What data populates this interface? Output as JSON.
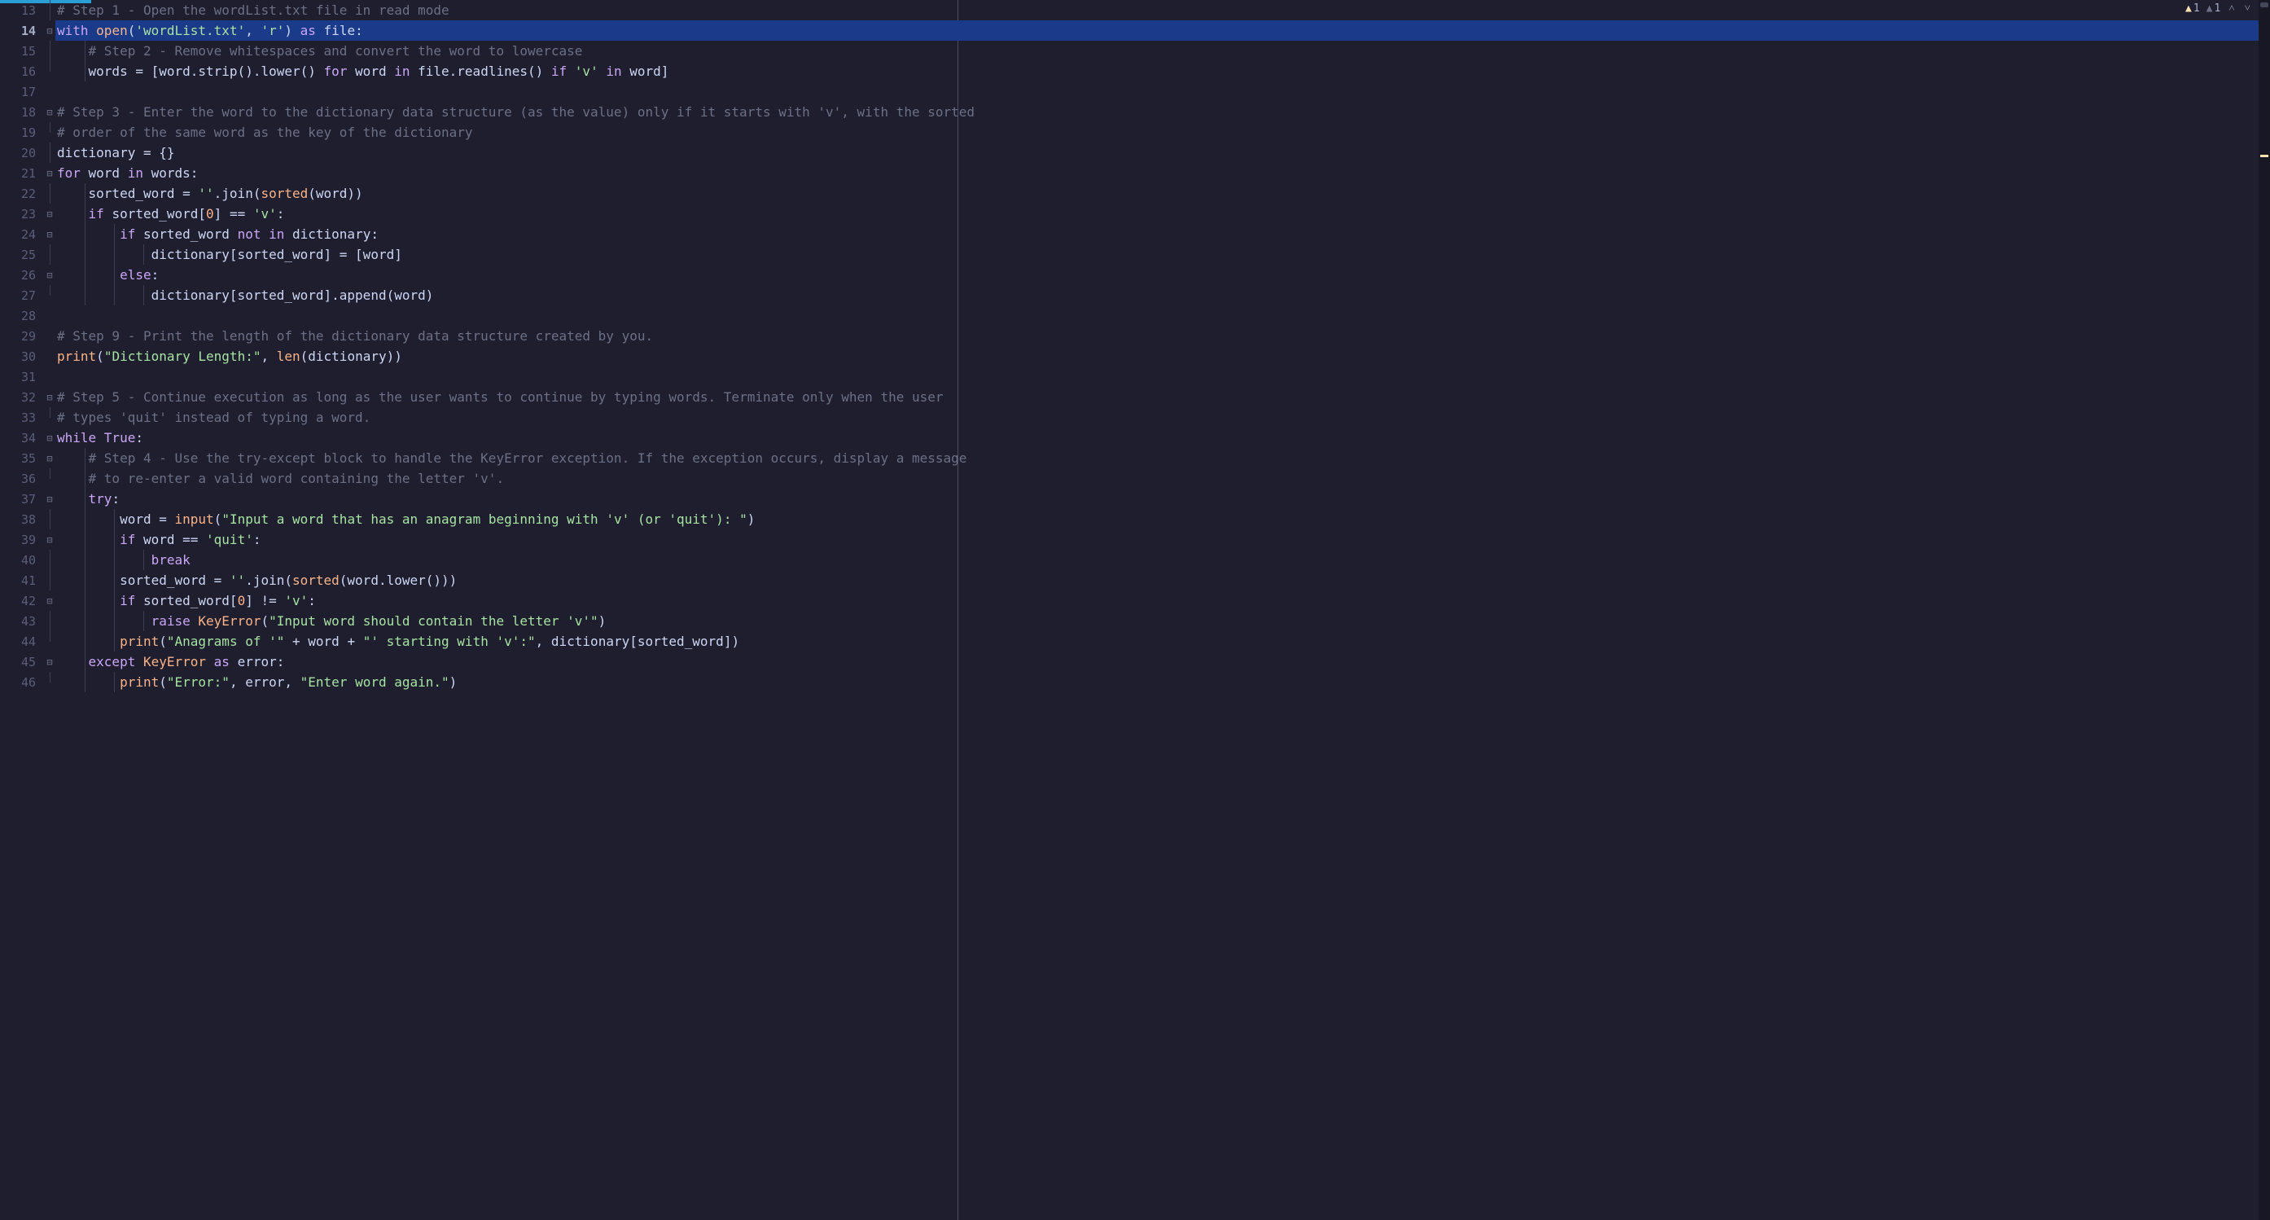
{
  "inspections": {
    "warn_active": "1",
    "warn_dim": "1"
  },
  "lines": [
    {
      "n": 13,
      "current": false,
      "hl": false,
      "fold": "line",
      "guides": [],
      "tokens": [
        {
          "t": "# Step 1 - Open the wordList.txt file in read mode",
          "c": "c-comment"
        }
      ]
    },
    {
      "n": 14,
      "current": true,
      "hl": true,
      "fold": "has",
      "guides": [],
      "tokens": [
        {
          "t": "with ",
          "c": "c-kw"
        },
        {
          "t": "open",
          "c": "c-builtin"
        },
        {
          "t": "(",
          "c": "c-id"
        },
        {
          "t": "'wordList.txt'",
          "c": "c-str"
        },
        {
          "t": ", ",
          "c": "c-id"
        },
        {
          "t": "'r'",
          "c": "c-str"
        },
        {
          "t": ") ",
          "c": "c-id"
        },
        {
          "t": "as ",
          "c": "c-kw"
        },
        {
          "t": "file:",
          "c": "c-id"
        }
      ]
    },
    {
      "n": 15,
      "current": false,
      "hl": false,
      "fold": "line",
      "guides": [
        1
      ],
      "tokens": [
        {
          "t": "    ",
          "c": ""
        },
        {
          "t": "# Step 2 - Remove whitespaces and convert the word to lowercase",
          "c": "c-comment"
        }
      ]
    },
    {
      "n": 16,
      "current": false,
      "hl": false,
      "fold": "end",
      "guides": [
        1
      ],
      "tokens": [
        {
          "t": "    words = [word.strip().lower() ",
          "c": "c-id"
        },
        {
          "t": "for ",
          "c": "c-kw"
        },
        {
          "t": "word ",
          "c": "c-id"
        },
        {
          "t": "in ",
          "c": "c-kw"
        },
        {
          "t": "file.readlines() ",
          "c": "c-id"
        },
        {
          "t": "if ",
          "c": "c-kw"
        },
        {
          "t": "'v'",
          "c": "c-str"
        },
        {
          "t": " ",
          "c": ""
        },
        {
          "t": "in ",
          "c": "c-kw"
        },
        {
          "t": "word]",
          "c": "c-id"
        }
      ]
    },
    {
      "n": 17,
      "current": false,
      "hl": false,
      "fold": "",
      "guides": [],
      "tokens": [
        {
          "t": "",
          "c": ""
        }
      ]
    },
    {
      "n": 18,
      "current": false,
      "hl": false,
      "fold": "has",
      "guides": [],
      "tokens": [
        {
          "t": "# Step 3 - Enter the word to the dictionary data structure (as the value) only if it starts with 'v', with the sorted",
          "c": "c-comment"
        }
      ]
    },
    {
      "n": 19,
      "current": false,
      "hl": false,
      "fold": "end",
      "guides": [],
      "tokens": [
        {
          "t": "# order of the same word as the key of the dictionary",
          "c": "c-comment"
        }
      ]
    },
    {
      "n": 20,
      "current": false,
      "hl": false,
      "fold": "line",
      "guides": [],
      "tokens": [
        {
          "t": "dictionary = {}",
          "c": "c-id"
        }
      ]
    },
    {
      "n": 21,
      "current": false,
      "hl": false,
      "fold": "has",
      "guides": [],
      "tokens": [
        {
          "t": "for ",
          "c": "c-kw"
        },
        {
          "t": "word ",
          "c": "c-id"
        },
        {
          "t": "in ",
          "c": "c-kw"
        },
        {
          "t": "words:",
          "c": "c-id"
        }
      ]
    },
    {
      "n": 22,
      "current": false,
      "hl": false,
      "fold": "line",
      "guides": [
        1
      ],
      "tokens": [
        {
          "t": "    sorted_word = ",
          "c": "c-id"
        },
        {
          "t": "''",
          "c": "c-str"
        },
        {
          "t": ".join(",
          "c": "c-id"
        },
        {
          "t": "sorted",
          "c": "c-builtin"
        },
        {
          "t": "(word))",
          "c": "c-id"
        }
      ]
    },
    {
      "n": 23,
      "current": false,
      "hl": false,
      "fold": "has",
      "guides": [
        1
      ],
      "tokens": [
        {
          "t": "    ",
          "c": ""
        },
        {
          "t": "if ",
          "c": "c-kw"
        },
        {
          "t": "sorted_word[",
          "c": "c-id"
        },
        {
          "t": "0",
          "c": "c-num"
        },
        {
          "t": "] == ",
          "c": "c-id"
        },
        {
          "t": "'v'",
          "c": "c-str"
        },
        {
          "t": ":",
          "c": "c-id"
        }
      ]
    },
    {
      "n": 24,
      "current": false,
      "hl": false,
      "fold": "has",
      "guides": [
        1,
        2
      ],
      "tokens": [
        {
          "t": "        ",
          "c": ""
        },
        {
          "t": "if ",
          "c": "c-kw"
        },
        {
          "t": "sorted_word ",
          "c": "c-id"
        },
        {
          "t": "not in ",
          "c": "c-kw"
        },
        {
          "t": "dictionary:",
          "c": "c-id"
        }
      ]
    },
    {
      "n": 25,
      "current": false,
      "hl": false,
      "fold": "line",
      "guides": [
        1,
        2,
        3
      ],
      "tokens": [
        {
          "t": "            dictionary[sorted_word] = [word]",
          "c": "c-id"
        }
      ]
    },
    {
      "n": 26,
      "current": false,
      "hl": false,
      "fold": "has",
      "guides": [
        1,
        2
      ],
      "tokens": [
        {
          "t": "        ",
          "c": ""
        },
        {
          "t": "else",
          "c": "c-kw"
        },
        {
          "t": ":",
          "c": "c-id"
        }
      ]
    },
    {
      "n": 27,
      "current": false,
      "hl": false,
      "fold": "end",
      "guides": [
        1,
        2,
        3
      ],
      "tokens": [
        {
          "t": "            dictionary[sorted_word].append(word)",
          "c": "c-id"
        }
      ]
    },
    {
      "n": 28,
      "current": false,
      "hl": false,
      "fold": "",
      "guides": [],
      "tokens": [
        {
          "t": "",
          "c": ""
        }
      ]
    },
    {
      "n": 29,
      "current": false,
      "hl": false,
      "fold": "",
      "guides": [],
      "tokens": [
        {
          "t": "# Step 9 - Print the length of the dictionary data structure created by you.",
          "c": "c-comment"
        }
      ]
    },
    {
      "n": 30,
      "current": false,
      "hl": false,
      "fold": "",
      "guides": [],
      "tokens": [
        {
          "t": "print",
          "c": "c-builtin"
        },
        {
          "t": "(",
          "c": "c-id"
        },
        {
          "t": "\"Dictionary Length:\"",
          "c": "c-str"
        },
        {
          "t": ", ",
          "c": "c-id"
        },
        {
          "t": "len",
          "c": "c-builtin"
        },
        {
          "t": "(dictionary))",
          "c": "c-id"
        }
      ]
    },
    {
      "n": 31,
      "current": false,
      "hl": false,
      "fold": "",
      "guides": [],
      "tokens": [
        {
          "t": "",
          "c": ""
        }
      ]
    },
    {
      "n": 32,
      "current": false,
      "hl": false,
      "fold": "has",
      "guides": [],
      "tokens": [
        {
          "t": "# Step 5 - Continue execution as long as the user wants to continue by typing words. Terminate only when the user",
          "c": "c-comment"
        }
      ]
    },
    {
      "n": 33,
      "current": false,
      "hl": false,
      "fold": "end",
      "guides": [],
      "tokens": [
        {
          "t": "# types 'quit' instead of typing a word.",
          "c": "c-comment"
        }
      ]
    },
    {
      "n": 34,
      "current": false,
      "hl": false,
      "fold": "has",
      "guides": [],
      "tokens": [
        {
          "t": "while ",
          "c": "c-kw"
        },
        {
          "t": "True",
          "c": "c-kw"
        },
        {
          "t": ":",
          "c": "c-id"
        }
      ]
    },
    {
      "n": 35,
      "current": false,
      "hl": false,
      "fold": "has",
      "guides": [
        1
      ],
      "tokens": [
        {
          "t": "    ",
          "c": ""
        },
        {
          "t": "# Step 4 - Use the try-except block to handle the KeyError exception. If the exception occurs, display a message",
          "c": "c-comment"
        }
      ]
    },
    {
      "n": 36,
      "current": false,
      "hl": false,
      "fold": "end",
      "guides": [
        1
      ],
      "tokens": [
        {
          "t": "    ",
          "c": ""
        },
        {
          "t": "# to re-enter a valid word containing the letter 'v'.",
          "c": "c-comment"
        }
      ]
    },
    {
      "n": 37,
      "current": false,
      "hl": false,
      "fold": "has",
      "guides": [
        1
      ],
      "tokens": [
        {
          "t": "    ",
          "c": ""
        },
        {
          "t": "try",
          "c": "c-kw"
        },
        {
          "t": ":",
          "c": "c-id"
        }
      ]
    },
    {
      "n": 38,
      "current": false,
      "hl": false,
      "fold": "line",
      "guides": [
        1,
        2
      ],
      "tokens": [
        {
          "t": "        word = ",
          "c": "c-id"
        },
        {
          "t": "input",
          "c": "c-builtin"
        },
        {
          "t": "(",
          "c": "c-id"
        },
        {
          "t": "\"Input a word that has an anagram beginning with 'v' (or 'quit'): \"",
          "c": "c-str"
        },
        {
          "t": ")",
          "c": "c-id"
        }
      ]
    },
    {
      "n": 39,
      "current": false,
      "hl": false,
      "fold": "has",
      "guides": [
        1,
        2
      ],
      "tokens": [
        {
          "t": "        ",
          "c": ""
        },
        {
          "t": "if ",
          "c": "c-kw"
        },
        {
          "t": "word == ",
          "c": "c-id"
        },
        {
          "t": "'quit'",
          "c": "c-str"
        },
        {
          "t": ":",
          "c": "c-id"
        }
      ]
    },
    {
      "n": 40,
      "current": false,
      "hl": false,
      "fold": "line",
      "guides": [
        1,
        2,
        3
      ],
      "tokens": [
        {
          "t": "            ",
          "c": ""
        },
        {
          "t": "break",
          "c": "c-kw"
        }
      ]
    },
    {
      "n": 41,
      "current": false,
      "hl": false,
      "fold": "line",
      "guides": [
        1,
        2
      ],
      "tokens": [
        {
          "t": "        sorted_word = ",
          "c": "c-id"
        },
        {
          "t": "''",
          "c": "c-str"
        },
        {
          "t": ".join(",
          "c": "c-id"
        },
        {
          "t": "sorted",
          "c": "c-builtin"
        },
        {
          "t": "(word.lower()))",
          "c": "c-id"
        }
      ]
    },
    {
      "n": 42,
      "current": false,
      "hl": false,
      "fold": "has",
      "guides": [
        1,
        2
      ],
      "tokens": [
        {
          "t": "        ",
          "c": ""
        },
        {
          "t": "if ",
          "c": "c-kw"
        },
        {
          "t": "sorted_word[",
          "c": "c-id"
        },
        {
          "t": "0",
          "c": "c-num"
        },
        {
          "t": "] != ",
          "c": "c-id"
        },
        {
          "t": "'v'",
          "c": "c-str"
        },
        {
          "t": ":",
          "c": "c-id"
        }
      ]
    },
    {
      "n": 43,
      "current": false,
      "hl": false,
      "fold": "line",
      "guides": [
        1,
        2,
        3
      ],
      "tokens": [
        {
          "t": "            ",
          "c": ""
        },
        {
          "t": "raise ",
          "c": "c-kw"
        },
        {
          "t": "KeyError",
          "c": "c-builtin"
        },
        {
          "t": "(",
          "c": "c-id"
        },
        {
          "t": "\"Input word should contain the letter 'v'\"",
          "c": "c-str"
        },
        {
          "t": ")",
          "c": "c-id"
        }
      ]
    },
    {
      "n": 44,
      "current": false,
      "hl": false,
      "fold": "end",
      "guides": [
        1,
        2
      ],
      "tokens": [
        {
          "t": "        ",
          "c": ""
        },
        {
          "t": "print",
          "c": "c-builtin"
        },
        {
          "t": "(",
          "c": "c-id"
        },
        {
          "t": "\"Anagrams of '\"",
          "c": "c-str"
        },
        {
          "t": " + word + ",
          "c": "c-id"
        },
        {
          "t": "\"' starting with 'v':\"",
          "c": "c-str"
        },
        {
          "t": ", dictionary[sorted_word])",
          "c": "c-id"
        }
      ]
    },
    {
      "n": 45,
      "current": false,
      "hl": false,
      "fold": "has",
      "guides": [
        1
      ],
      "tokens": [
        {
          "t": "    ",
          "c": ""
        },
        {
          "t": "except ",
          "c": "c-kw"
        },
        {
          "t": "KeyError ",
          "c": "c-builtin"
        },
        {
          "t": "as ",
          "c": "c-kw"
        },
        {
          "t": "error:",
          "c": "c-id"
        }
      ]
    },
    {
      "n": 46,
      "current": false,
      "hl": false,
      "fold": "end",
      "guides": [
        1,
        2
      ],
      "tokens": [
        {
          "t": "        ",
          "c": ""
        },
        {
          "t": "print",
          "c": "c-builtin"
        },
        {
          "t": "(",
          "c": "c-id"
        },
        {
          "t": "\"Error:\"",
          "c": "c-str"
        },
        {
          "t": ", error, ",
          "c": "c-id"
        },
        {
          "t": "\"Enter word again.\"",
          "c": "c-str"
        },
        {
          "t": ")",
          "c": "c-id"
        }
      ]
    }
  ]
}
